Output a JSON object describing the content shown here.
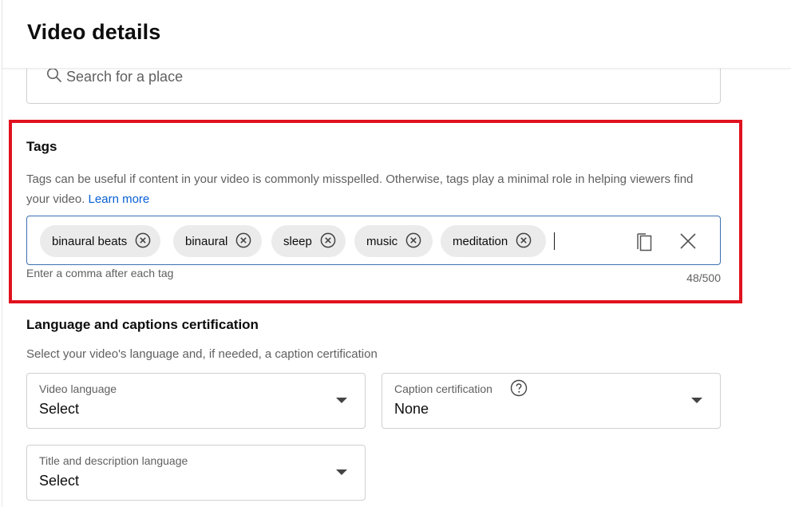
{
  "header": {
    "title": "Video details"
  },
  "location": {
    "placeholder": "Search for a place",
    "icon": "search-icon"
  },
  "tags": {
    "title": "Tags",
    "description": "Tags can be useful if content in your video is commonly misspelled. Otherwise, tags play a minimal role in helping viewers find your video.",
    "learn_more": "Learn more",
    "items": [
      {
        "label": "binaural beats"
      },
      {
        "label": "binaural"
      },
      {
        "label": "sleep"
      },
      {
        "label": "music"
      },
      {
        "label": "meditation"
      }
    ],
    "hint": "Enter a comma after each tag",
    "count": "48/500",
    "field_border_color": "#3c6fb0",
    "highlight_color": "#e0121e"
  },
  "language": {
    "title": "Language and captions certification",
    "description": "Select your video's language and, if needed, a caption certification",
    "video_language": {
      "label": "Video language",
      "value": "Select"
    },
    "caption_certification": {
      "label": "Caption certification",
      "value": "None"
    },
    "title_description_language": {
      "label": "Title and description language",
      "value": "Select"
    }
  },
  "colors": {
    "link": "#065fd4",
    "secondary_text": "#606060",
    "chip_background": "#ebebeb"
  }
}
